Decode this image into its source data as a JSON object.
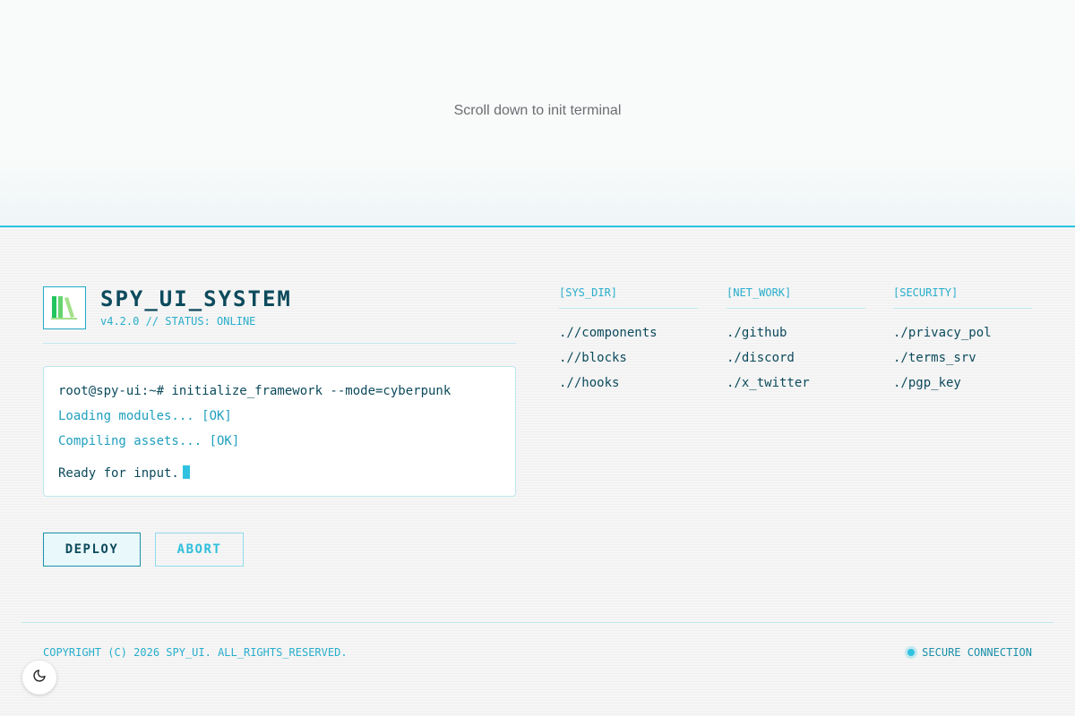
{
  "hero": {
    "text": "Scroll down to init terminal"
  },
  "brand": {
    "title": "SPY_UI_SYSTEM",
    "subtitle": "v4.2.0 // STATUS: ONLINE",
    "logo_icon": "books-icon"
  },
  "terminal": {
    "command": "root@spy-ui:~# initialize_framework --mode=cyberpunk",
    "lines": [
      "Loading modules... [OK]",
      "Compiling assets... [OK]"
    ],
    "ready": "Ready for input."
  },
  "buttons": {
    "deploy": "DEPLOY",
    "abort": "ABORT"
  },
  "columns": [
    {
      "heading": "[SYS_DIR]",
      "links": [
        ".//components",
        ".//blocks",
        ".//hooks"
      ]
    },
    {
      "heading": "[NET_WORK]",
      "links": [
        "./github",
        "./discord",
        "./x_twitter"
      ]
    },
    {
      "heading": "[SECURITY]",
      "links": [
        "./privacy_pol",
        "./terms_srv",
        "./pgp_key"
      ]
    }
  ],
  "footer": {
    "copyright": "COPYRIGHT (C) 2026 SPY_UI. ALL_RIGHTS_RESERVED.",
    "secure": "SECURE CONNECTION"
  },
  "colors": {
    "accent": "#29c3e3",
    "text_dark": "#0c4a5c"
  },
  "theme_toggle_icon": "moon-icon"
}
